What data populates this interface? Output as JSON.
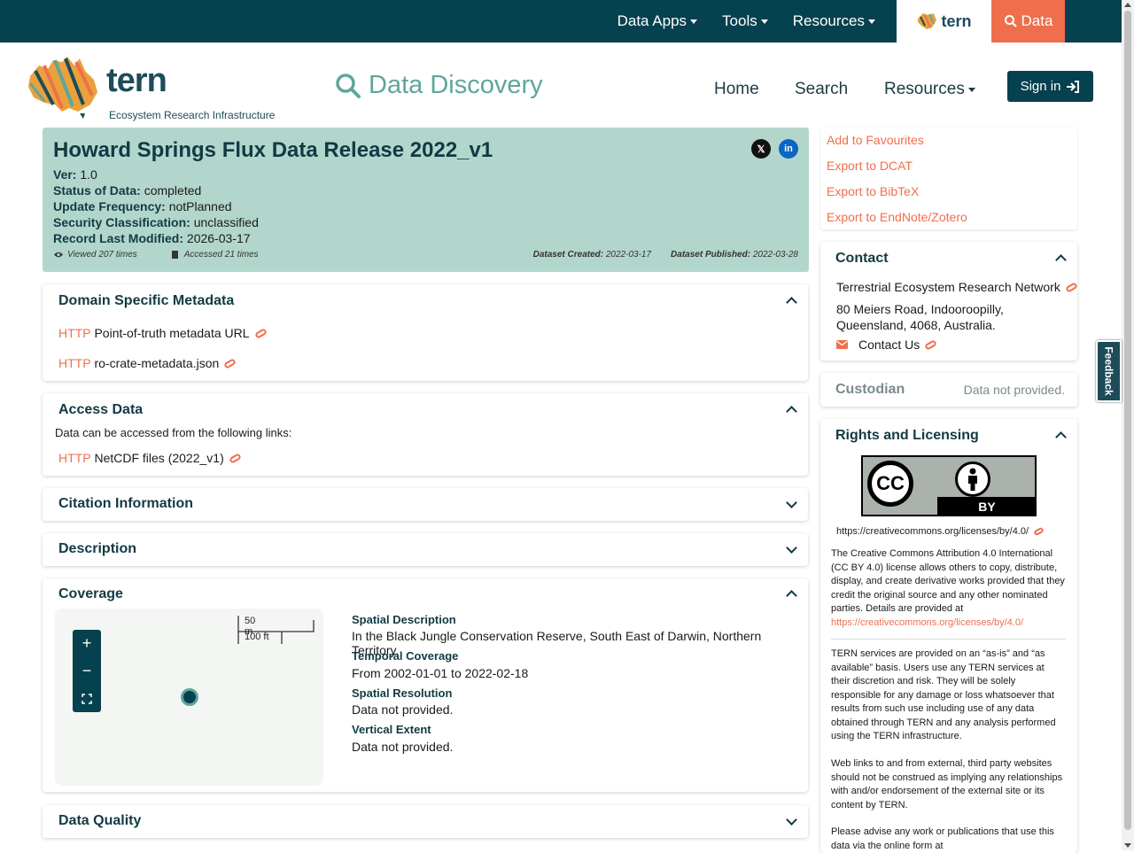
{
  "topnav": {
    "data_apps": "Data Apps",
    "tools": "Tools",
    "resources": "Resources",
    "tern": "tern",
    "data": "Data"
  },
  "header": {
    "logo_word": "tern",
    "logo_sub": "Ecosystem Research Infrastructure",
    "data_discovery": "Data Discovery",
    "home": "Home",
    "search": "Search",
    "resources": "Resources",
    "sign_in": "Sign in"
  },
  "record": {
    "title": "Howard Springs Flux Data Release 2022_v1",
    "ver_label": "Ver:",
    "ver": "1.0",
    "status_label": "Status of Data:",
    "status": "completed",
    "update_label": "Update Frequency:",
    "update": "notPlanned",
    "security_label": "Security Classification:",
    "security": "unclassified",
    "modified_label": "Record Last Modified:",
    "modified": "2026-03-17",
    "viewed": "Viewed 207 times",
    "accessed": "Accessed 21 times",
    "created_label": "Dataset Created:",
    "created": "2022-03-17",
    "published_label": "Dataset Published:",
    "published": "2022-03-28"
  },
  "domain": {
    "title": "Domain Specific Metadata",
    "links": [
      {
        "proto": "HTTP",
        "label": "Point-of-truth metadata URL"
      },
      {
        "proto": "HTTP",
        "label": "ro-crate-metadata.json"
      }
    ]
  },
  "access": {
    "title": "Access Data",
    "intro": "Data can be accessed from the following links:",
    "link": {
      "proto": "HTTP",
      "label": "NetCDF files (2022_v1)"
    }
  },
  "citation": {
    "title": "Citation Information"
  },
  "description": {
    "title": "Description"
  },
  "coverage": {
    "title": "Coverage",
    "scale_m": "50 m",
    "scale_ft": "100 ft",
    "spatial_desc_label": "Spatial Description",
    "spatial_desc": "In the Black Jungle Conservation Reserve, South East of Darwin, Northern Territory.",
    "temporal_label": "Temporal Coverage",
    "temporal": "From 2002-01-01 to 2022-02-18",
    "resolution_label": "Spatial Resolution",
    "resolution": "Data not provided.",
    "vertical_label": "Vertical Extent",
    "vertical": "Data not provided."
  },
  "quality": {
    "title": "Data Quality"
  },
  "actions": {
    "fav": "Add to Favourites",
    "dcat": "Export to DCAT",
    "bibtex": "Export to BibTeX",
    "endnote": "Export to EndNote/Zotero"
  },
  "contact": {
    "title": "Contact",
    "org": "Terrestrial Ecosystem Research Network",
    "address": "80 Meiers Road, Indooroopilly, Queensland, 4068, Australia.",
    "contact_us": "Contact Us"
  },
  "custodian": {
    "title": "Custodian",
    "value": "Data not provided."
  },
  "rights": {
    "title": "Rights and Licensing",
    "cc": "CC",
    "by": "BY",
    "license_url": "https://creativecommons.org/licenses/by/4.0/",
    "p1": "The Creative Commons Attribution 4.0 International (CC BY 4.0) license allows others to copy, distribute, display, and create derivative works provided that they credit the original source and any other nominated parties. Details are provided at",
    "p1_link": "https://creativecommons.org/licenses/by/4.0/",
    "p2": "TERN services are provided on an “as-is” and “as available” basis. Users use any TERN services at their discretion and risk. They will be solely responsible for any damage or loss whatsoever that results from such use including use of any data obtained through TERN and any analysis performed using the TERN infrastructure.",
    "p3": "Web links to and from external, third party websites should not be construed as implying any relationships with and/or endorsement of the external site or its content by TERN.",
    "p4": "Please advise any work or publications that use this data via the online form at"
  },
  "feedback": "Feedback",
  "colors": {
    "navy": "#06414f",
    "orange": "#ef6f4d",
    "teal": "#5fa69a",
    "title_bg": "#b3d6cc"
  }
}
